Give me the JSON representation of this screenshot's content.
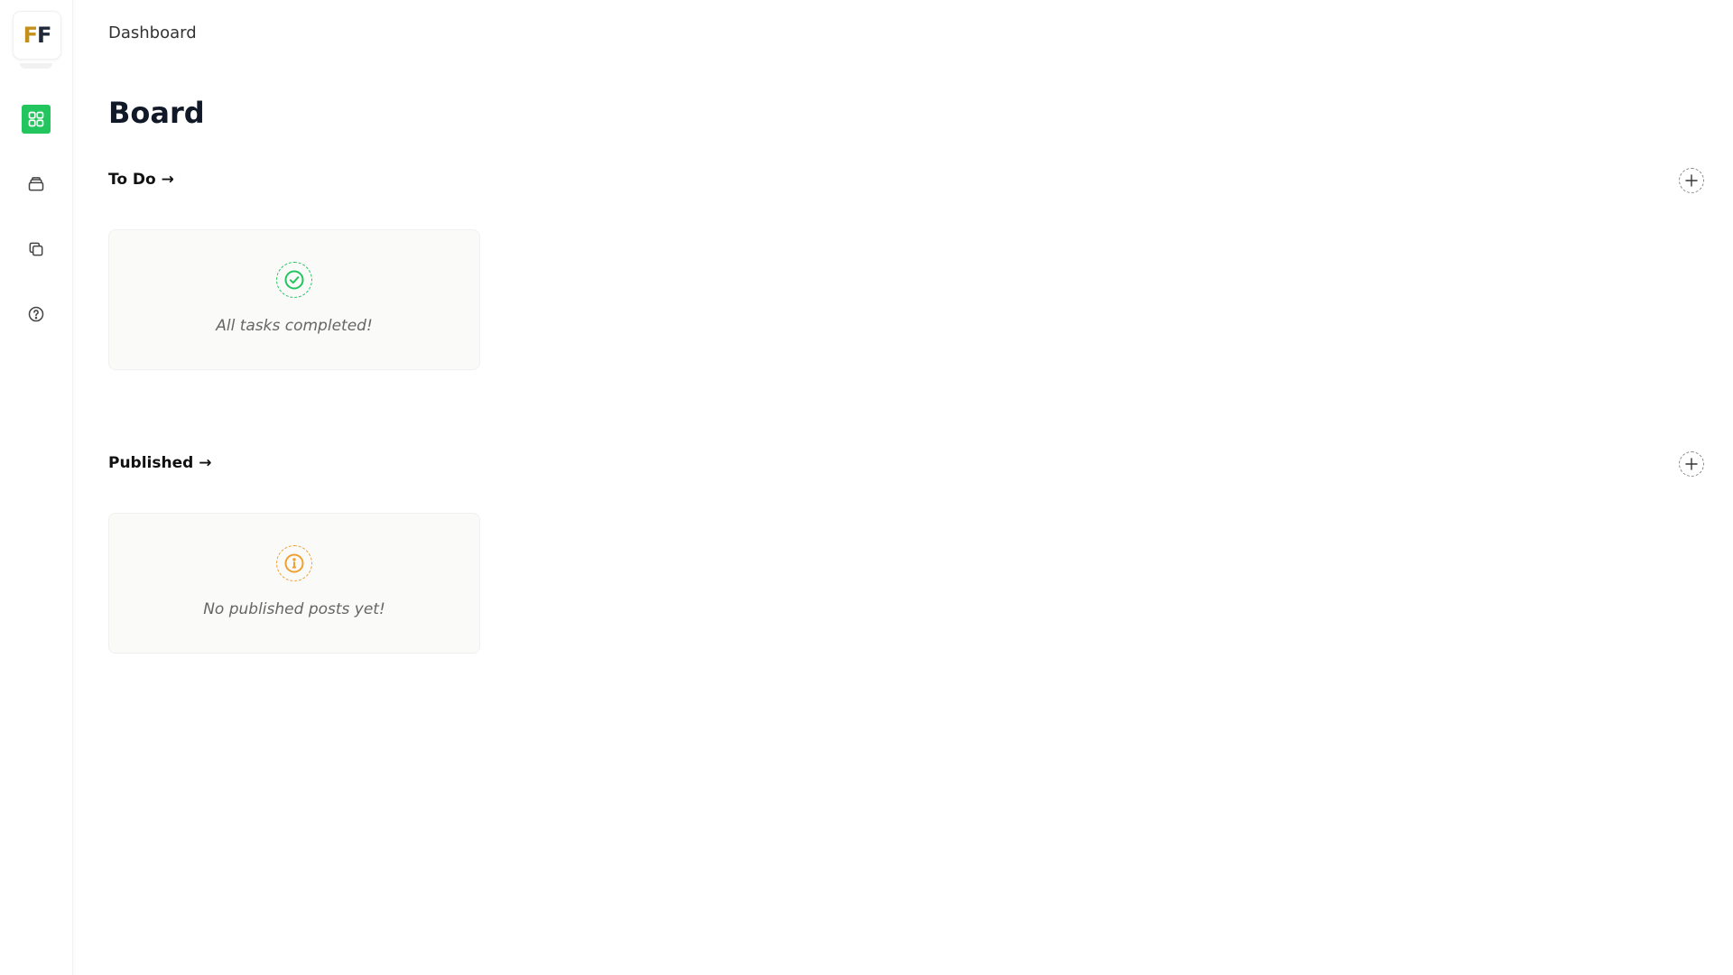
{
  "sidebar": {
    "logo": {
      "letter1": "F",
      "letter2": "F"
    },
    "items": [
      {
        "name": "dashboard",
        "icon": "grid-icon",
        "active": true
      },
      {
        "name": "inbox",
        "icon": "archive-icon",
        "active": false
      },
      {
        "name": "copy",
        "icon": "copy-icon",
        "active": false
      },
      {
        "name": "help",
        "icon": "help-circle-icon",
        "active": false
      }
    ]
  },
  "header": {
    "breadcrumb": "Dashboard",
    "title": "Board"
  },
  "sections": [
    {
      "title": "To Do →",
      "empty_text": "All tasks completed!",
      "status_icon": "check-circle-icon"
    },
    {
      "title": "Published →",
      "empty_text": "No published posts yet!",
      "status_icon": "info-circle-icon"
    }
  ],
  "colors": {
    "accent": "#22c55e",
    "warning": "#f0a030",
    "logo_gold": "#c4901c",
    "text_dark": "#111827",
    "text_muted": "#666666"
  }
}
